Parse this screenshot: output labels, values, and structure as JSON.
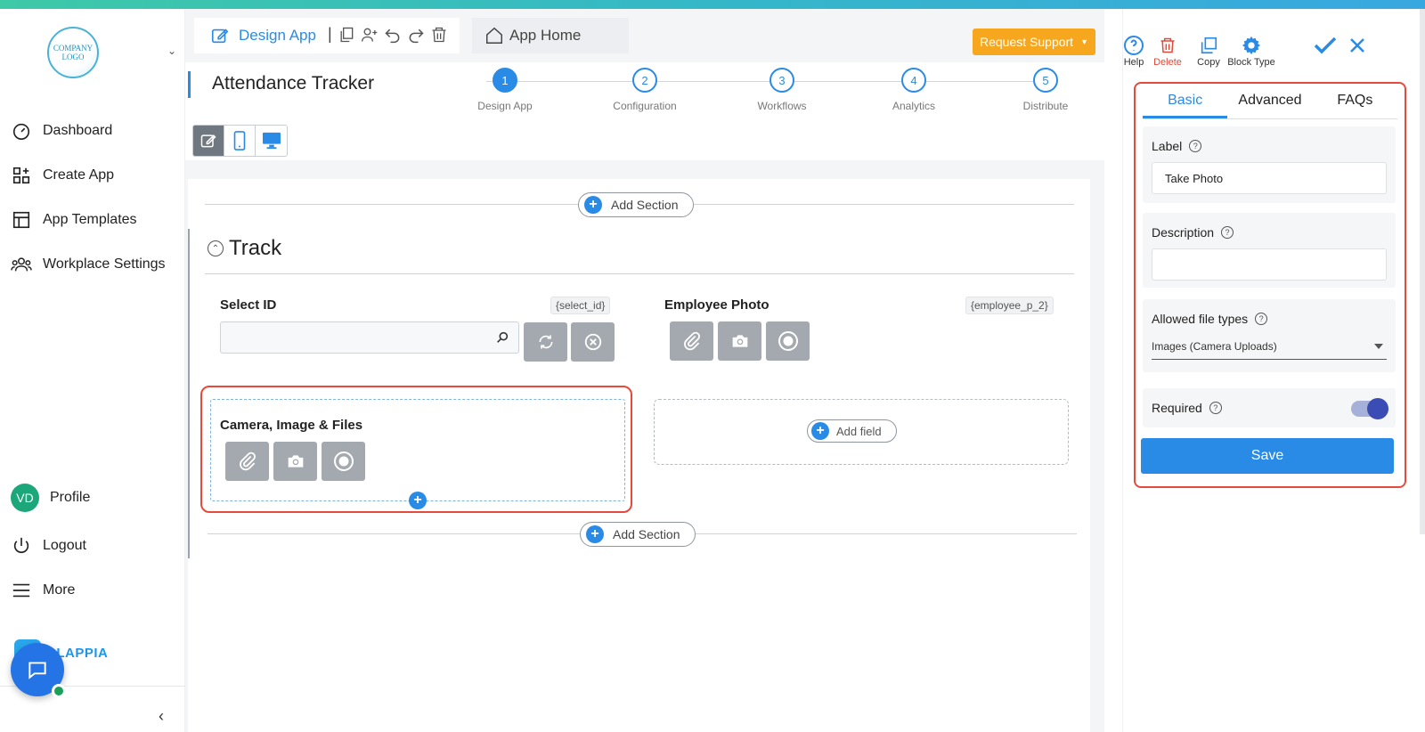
{
  "sidebar": {
    "logo_text": "COMPANY LOGO",
    "items": [
      {
        "label": "Dashboard",
        "icon": "gauge-icon"
      },
      {
        "label": "Create App",
        "icon": "apps-plus-icon"
      },
      {
        "label": "App Templates",
        "icon": "template-icon"
      },
      {
        "label": "Workplace Settings",
        "icon": "people-icon"
      }
    ],
    "profile": {
      "initials": "VD",
      "label": "Profile"
    },
    "logout_label": "Logout",
    "more_label": "More",
    "brand": "CLAPPIA"
  },
  "topbar": {
    "design_tab": "Design App",
    "home_tab": "App Home",
    "request_support": "Request Support"
  },
  "app": {
    "title": "Attendance Tracker",
    "steps": [
      {
        "num": "1",
        "label": "Design App",
        "active": true
      },
      {
        "num": "2",
        "label": "Configuration"
      },
      {
        "num": "3",
        "label": "Workflows"
      },
      {
        "num": "4",
        "label": "Analytics"
      },
      {
        "num": "5",
        "label": "Distribute"
      }
    ]
  },
  "canvas": {
    "add_section": "Add Section",
    "section_title": "Track",
    "fields": {
      "select_id": {
        "label": "Select ID",
        "key": "{select_id}"
      },
      "employee_photo": {
        "label": "Employee Photo",
        "key": "{employee_p_2}"
      },
      "camera": {
        "label": "Camera, Image & Files"
      }
    },
    "add_field": "Add field"
  },
  "panel": {
    "tools": {
      "help": "Help",
      "delete": "Delete",
      "copy": "Copy",
      "block_type": "Block Type"
    },
    "tabs": [
      "Basic",
      "Advanced",
      "FAQs"
    ],
    "label_title": "Label",
    "label_value": "Take Photo",
    "description_title": "Description",
    "description_value": "",
    "file_types_title": "Allowed file types",
    "file_types_value": "Images (Camera Uploads)",
    "required_title": "Required",
    "required_on": true,
    "save": "Save"
  },
  "colors": {
    "accent": "#2a8be6",
    "warning": "#f6a71e",
    "danger": "#e44b3c"
  }
}
